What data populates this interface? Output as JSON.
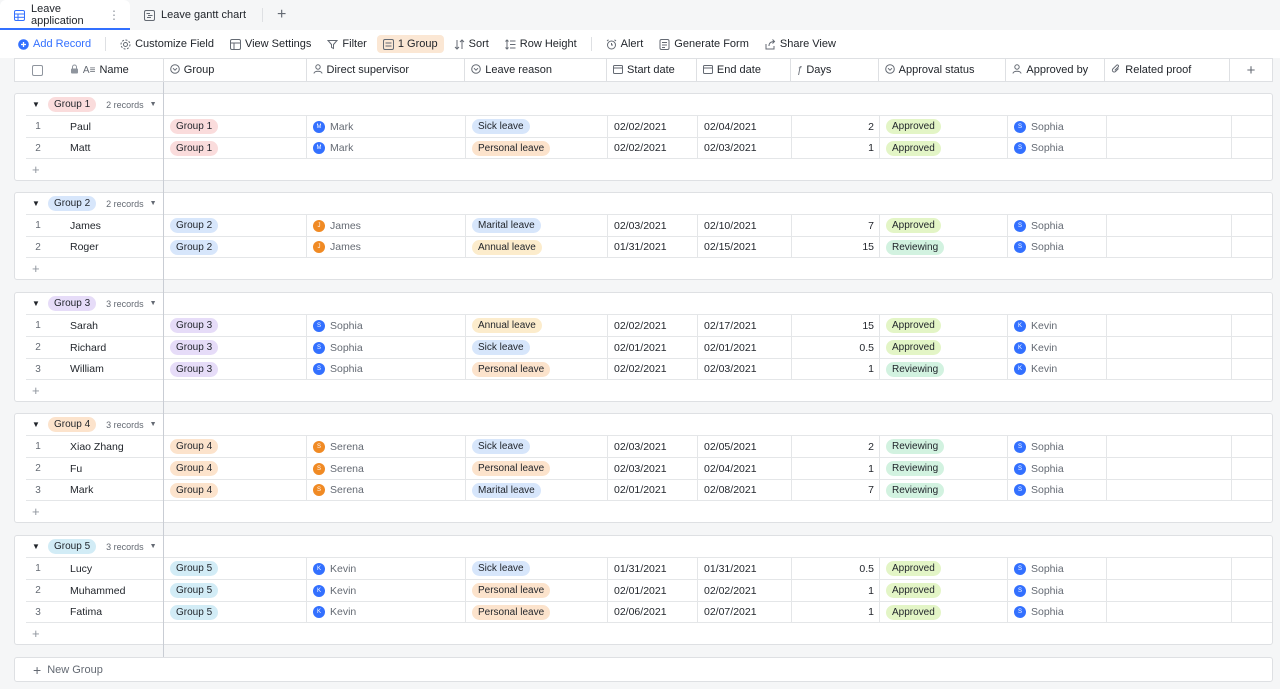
{
  "tabs": [
    {
      "label": "Leave application",
      "active": true
    },
    {
      "label": "Leave gantt chart",
      "active": false
    }
  ],
  "toolbar": {
    "add_record": "Add Record",
    "customize_field": "Customize Field",
    "view_settings": "View Settings",
    "filter": "Filter",
    "group": "1 Group",
    "sort": "Sort",
    "row_height": "Row Height",
    "alert": "Alert",
    "generate_form": "Generate Form",
    "share_view": "Share View"
  },
  "columns": [
    "Name",
    "Group",
    "Direct supervisor",
    "Leave reason",
    "Start date",
    "End date",
    "Days",
    "Approval status",
    "Approved by",
    "Related proof"
  ],
  "colors": {
    "accent": "#3370ff",
    "group_1": "#fadcdc",
    "group_2": "#d7e6fb",
    "group_3": "#e6dcf8",
    "group_4": "#fce3cc",
    "group_5": "#d2ecf6",
    "sick": "#d7e6fb",
    "personal": "#fce3cc",
    "marital": "#d7e6fb",
    "annual": "#fceccc",
    "approved": "#e3f5c6",
    "reviewing": "#d2f2e0",
    "av_mark": "#3370ff",
    "av_james": "#f08a24",
    "av_sophia": "#3370ff",
    "av_serena": "#f08a24",
    "av_kevin": "#3370ff"
  },
  "groups": [
    {
      "label": "Group 1",
      "count": "2 records",
      "color_key": "group_1",
      "rows": [
        {
          "idx": "1",
          "name": "Paul",
          "group": "Group 1",
          "sup": "Mark",
          "sup_init": "M",
          "sup_color": "av_mark",
          "reason": "Sick leave",
          "reason_key": "sick",
          "start": "02/02/2021",
          "end": "02/04/2021",
          "days": "2",
          "status": "Approved",
          "status_key": "approved",
          "appr": "Sophia",
          "appr_init": "S",
          "appr_color": "av_sophia"
        },
        {
          "idx": "2",
          "name": "Matt",
          "group": "Group 1",
          "sup": "Mark",
          "sup_init": "M",
          "sup_color": "av_mark",
          "reason": "Personal leave",
          "reason_key": "personal",
          "start": "02/02/2021",
          "end": "02/03/2021",
          "days": "1",
          "status": "Approved",
          "status_key": "approved",
          "appr": "Sophia",
          "appr_init": "S",
          "appr_color": "av_sophia"
        }
      ]
    },
    {
      "label": "Group 2",
      "count": "2 records",
      "color_key": "group_2",
      "rows": [
        {
          "idx": "1",
          "name": "James",
          "group": "Group 2",
          "sup": "James",
          "sup_init": "J",
          "sup_color": "av_james",
          "reason": "Marital leave",
          "reason_key": "marital",
          "start": "02/03/2021",
          "end": "02/10/2021",
          "days": "7",
          "status": "Approved",
          "status_key": "approved",
          "appr": "Sophia",
          "appr_init": "S",
          "appr_color": "av_sophia"
        },
        {
          "idx": "2",
          "name": "Roger",
          "group": "Group 2",
          "sup": "James",
          "sup_init": "J",
          "sup_color": "av_james",
          "reason": "Annual leave",
          "reason_key": "annual",
          "start": "01/31/2021",
          "end": "02/15/2021",
          "days": "15",
          "status": "Reviewing",
          "status_key": "reviewing",
          "appr": "Sophia",
          "appr_init": "S",
          "appr_color": "av_sophia"
        }
      ]
    },
    {
      "label": "Group 3",
      "count": "3 records",
      "color_key": "group_3",
      "rows": [
        {
          "idx": "1",
          "name": "Sarah",
          "group": "Group 3",
          "sup": "Sophia",
          "sup_init": "S",
          "sup_color": "av_sophia",
          "reason": "Annual leave",
          "reason_key": "annual",
          "start": "02/02/2021",
          "end": "02/17/2021",
          "days": "15",
          "status": "Approved",
          "status_key": "approved",
          "appr": "Kevin",
          "appr_init": "K",
          "appr_color": "av_kevin"
        },
        {
          "idx": "2",
          "name": "Richard",
          "group": "Group 3",
          "sup": "Sophia",
          "sup_init": "S",
          "sup_color": "av_sophia",
          "reason": "Sick leave",
          "reason_key": "sick",
          "start": "02/01/2021",
          "end": "02/01/2021",
          "days": "0.5",
          "status": "Approved",
          "status_key": "approved",
          "appr": "Kevin",
          "appr_init": "K",
          "appr_color": "av_kevin"
        },
        {
          "idx": "3",
          "name": "William",
          "group": "Group 3",
          "sup": "Sophia",
          "sup_init": "S",
          "sup_color": "av_sophia",
          "reason": "Personal leave",
          "reason_key": "personal",
          "start": "02/02/2021",
          "end": "02/03/2021",
          "days": "1",
          "status": "Reviewing",
          "status_key": "reviewing",
          "appr": "Kevin",
          "appr_init": "K",
          "appr_color": "av_kevin"
        }
      ]
    },
    {
      "label": "Group 4",
      "count": "3 records",
      "color_key": "group_4",
      "rows": [
        {
          "idx": "1",
          "name": "Xiao Zhang",
          "group": "Group 4",
          "sup": "Serena",
          "sup_init": "S",
          "sup_color": "av_serena",
          "reason": "Sick leave",
          "reason_key": "sick",
          "start": "02/03/2021",
          "end": "02/05/2021",
          "days": "2",
          "status": "Reviewing",
          "status_key": "reviewing",
          "appr": "Sophia",
          "appr_init": "S",
          "appr_color": "av_sophia"
        },
        {
          "idx": "2",
          "name": "Fu",
          "group": "Group 4",
          "sup": "Serena",
          "sup_init": "S",
          "sup_color": "av_serena",
          "reason": "Personal leave",
          "reason_key": "personal",
          "start": "02/03/2021",
          "end": "02/04/2021",
          "days": "1",
          "status": "Reviewing",
          "status_key": "reviewing",
          "appr": "Sophia",
          "appr_init": "S",
          "appr_color": "av_sophia"
        },
        {
          "idx": "3",
          "name": "Mark",
          "group": "Group 4",
          "sup": "Serena",
          "sup_init": "S",
          "sup_color": "av_serena",
          "reason": "Marital leave",
          "reason_key": "marital",
          "start": "02/01/2021",
          "end": "02/08/2021",
          "days": "7",
          "status": "Reviewing",
          "status_key": "reviewing",
          "appr": "Sophia",
          "appr_init": "S",
          "appr_color": "av_sophia"
        }
      ]
    },
    {
      "label": "Group 5",
      "count": "3 records",
      "color_key": "group_5",
      "rows": [
        {
          "idx": "1",
          "name": "Lucy",
          "group": "Group 5",
          "sup": "Kevin",
          "sup_init": "K",
          "sup_color": "av_kevin",
          "reason": "Sick leave",
          "reason_key": "sick",
          "start": "01/31/2021",
          "end": "01/31/2021",
          "days": "0.5",
          "status": "Approved",
          "status_key": "approved",
          "appr": "Sophia",
          "appr_init": "S",
          "appr_color": "av_sophia"
        },
        {
          "idx": "2",
          "name": "Muhammed",
          "group": "Group 5",
          "sup": "Kevin",
          "sup_init": "K",
          "sup_color": "av_kevin",
          "reason": "Personal leave",
          "reason_key": "personal",
          "start": "02/01/2021",
          "end": "02/02/2021",
          "days": "1",
          "status": "Approved",
          "status_key": "approved",
          "appr": "Sophia",
          "appr_init": "S",
          "appr_color": "av_sophia"
        },
        {
          "idx": "3",
          "name": "Fatima",
          "group": "Group 5",
          "sup": "Kevin",
          "sup_init": "K",
          "sup_color": "av_kevin",
          "reason": "Personal leave",
          "reason_key": "personal",
          "start": "02/06/2021",
          "end": "02/07/2021",
          "days": "1",
          "status": "Approved",
          "status_key": "approved",
          "appr": "Sophia",
          "appr_init": "S",
          "appr_color": "av_sophia"
        }
      ]
    }
  ],
  "new_group": "New Group"
}
